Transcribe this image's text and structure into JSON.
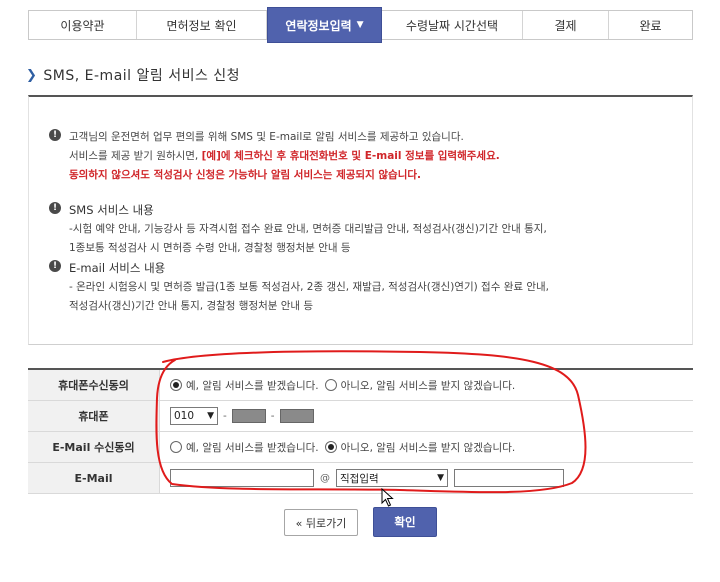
{
  "steps": [
    {
      "label": "이용약관"
    },
    {
      "label": "면허정보 확인"
    },
    {
      "label": "연락정보입력"
    },
    {
      "label": "수령날짜 시간선택"
    },
    {
      "label": "결제"
    },
    {
      "label": "완료"
    }
  ],
  "section_title": "SMS, E-mail 알림 서비스 신청",
  "info": {
    "intro_line1": "고객님의 운전면허 업무 편의를 위해 SMS 및 E-mail로 알림 서비스를 제공하고 있습니다.",
    "intro_line2_plain": "서비스를 제공 받기 원하시면, ",
    "intro_line2_highlight": "[예]에 체크하신 후 휴대전화번호 및 E-mail 정보를 입력해주세요.",
    "intro_line3_highlight": "동의하지 않으셔도 적성검사 신청은 가능하나 알림 서비스는 제공되지 않습니다.",
    "sms_head": "SMS 서비스 내용",
    "sms_line1": "-시험 예약 안내, 기능강사 등 자격시험 접수 완료 안내, 면허증 대리발급 안내, 적성검사(갱신)기간 안내 통지,",
    "sms_line2": "1종보통 적성검사 시 면허증 수령 안내, 경찰청 행정처분 안내 등",
    "email_head": "E-mail 서비스 내용",
    "email_line1": "- 온라인 시험응시 및 면허증 발급(1종 보통 적성검사, 2종 갱신, 재발급, 적성검사(갱신)연기) 접수 완료 안내,",
    "email_line2": "적성검사(갱신)기간 안내 통지, 경찰청 행정처분 안내 등"
  },
  "form": {
    "phone_agree": {
      "label": "휴대폰수신동의",
      "yes": "예, 알림 서비스를 받겠습니다.",
      "no": "아니오, 알림 서비스를 받지 않겠습니다.",
      "selected": "yes"
    },
    "phone": {
      "label": "휴대폰",
      "prefix": "010",
      "sep": "-"
    },
    "email_agree": {
      "label": "E-Mail 수신동의",
      "yes": "예, 알림 서비스를 받겠습니다.",
      "no": "아니오, 알림 서비스를 받지 않겠습니다.",
      "selected": "no"
    },
    "email": {
      "label": "E-Mail",
      "at": "@",
      "domain_select": "직접입력"
    }
  },
  "buttons": {
    "back": "« 뒤로가기",
    "confirm": "확인"
  },
  "colors": {
    "accent": "#5062ad",
    "highlight": "#d0262a",
    "annotation": "#e01b1b"
  },
  "icons": {
    "step_active": "chevron-down-icon",
    "title_bullet": "chevron-right-icon",
    "info": "exclamation-icon",
    "cursor": "mouse-pointer-icon"
  }
}
